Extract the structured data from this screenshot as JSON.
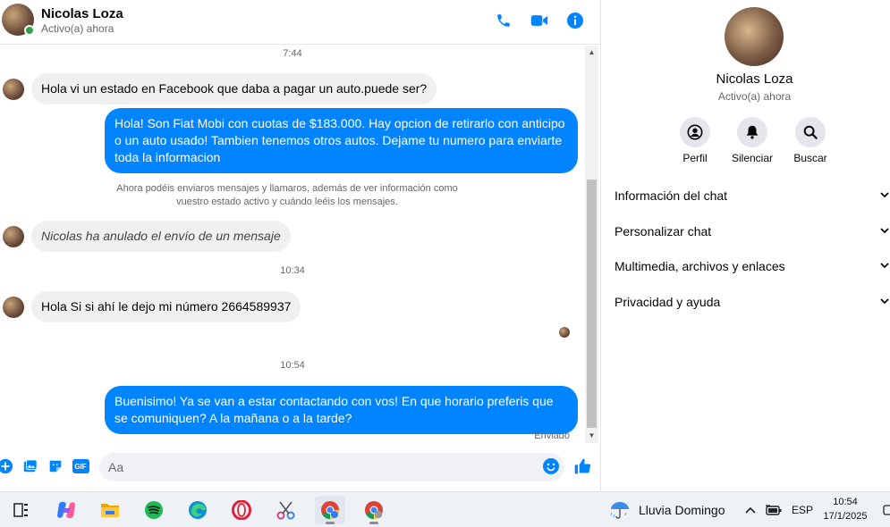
{
  "header": {
    "name": "Nicolas Loza",
    "status": "Activo(a) ahora",
    "icons": [
      "phone-icon",
      "video-icon",
      "info-icon"
    ]
  },
  "messages": {
    "ts1": "7:44",
    "m1": "Hola vi un estado en Facebook que daba a pagar un auto.puede ser?",
    "m2": "Hola! Son Fiat Mobi con cuotas de $183.000. Hay opcion de retirarlo con anticipo o un auto usado! Tambien tenemos otros autos. Dejame tu numero para enviarte toda la informacion",
    "system_note": "Ahora podéis enviaros mensajes y llamaros, además de ver información como vuestro estado activo y cuándo leéis los mensajes.",
    "m3": "Nicolas ha anulado el envío de un mensaje",
    "ts2": "10:34",
    "m4": "Hola Si si ahí le dejo mi número 2664589937",
    "ts3": "10:54",
    "m5": "Buenisimo! Ya se van a estar contactando con vos! En que horario preferis que se comuniquen? A la mañana o a la tarde?",
    "sent_label": "Enviado"
  },
  "composer": {
    "placeholder": "Aa",
    "icons": [
      "plus-icon",
      "image-icon",
      "sticker-icon",
      "gif-icon",
      "emoji-icon",
      "like-icon"
    ],
    "gif_label": "GIF"
  },
  "info": {
    "name": "Nicolas Loza",
    "status": "Activo(a) ahora",
    "actions": [
      {
        "label": "Perfil",
        "icon": "profile-icon"
      },
      {
        "label": "Silenciar",
        "icon": "bell-icon"
      },
      {
        "label": "Buscar",
        "icon": "search-icon"
      }
    ],
    "sections": [
      "Información del chat",
      "Personalizar chat",
      "Multimedia, archivos y enlaces",
      "Privacidad y ayuda"
    ]
  },
  "taskbar": {
    "weather": "Lluvia Domingo",
    "lang": "ESP",
    "time": "10:54",
    "date": "17/1/2025",
    "apps": [
      "task-view-icon",
      "copilot-icon",
      "file-explorer-icon",
      "spotify-icon",
      "edge-icon",
      "opera-icon",
      "snipping-tool-icon",
      "chrome-icon",
      "chrome-profile-icon"
    ]
  },
  "colors": {
    "accent": "#0084ff",
    "incoming_bubble": "#f0f0f0",
    "online": "#31a24c"
  }
}
